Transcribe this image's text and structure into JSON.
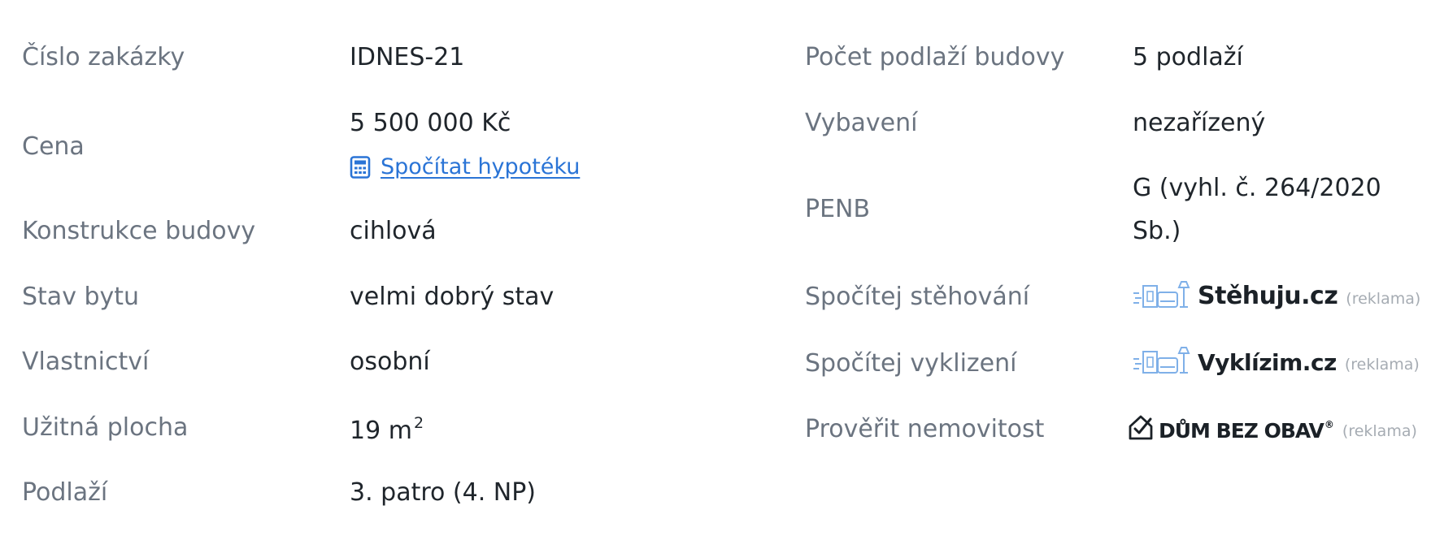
{
  "left": {
    "order_number": {
      "label": "Číslo zakázky",
      "value": "IDNES-21"
    },
    "price": {
      "label": "Cena",
      "value": "5 500 000 Kč",
      "link": "Spočítat hypotéku"
    },
    "construction": {
      "label": "Konstrukce budovy",
      "value": "cihlová"
    },
    "condition": {
      "label": "Stav bytu",
      "value": "velmi dobrý stav"
    },
    "ownership": {
      "label": "Vlastnictví",
      "value": "osobní"
    },
    "area": {
      "label": "Užitná plocha",
      "value": "19 m",
      "unit_sup": "2"
    },
    "floor": {
      "label": "Podlaží",
      "value": "3. patro (4. NP)"
    }
  },
  "right": {
    "building_floors": {
      "label": "Počet podlaží budovy",
      "value": "5 podlaží"
    },
    "furnishing": {
      "label": "Vybavení",
      "value": "nezařízený"
    },
    "penb": {
      "label": "PENB",
      "value_line1": "G (vyhl. č. 264/2020",
      "value_line2": "Sb.)"
    },
    "moving": {
      "label": "Spočítej stěhování",
      "brand": "Stěhuju.cz",
      "note": "(reklama)"
    },
    "clearing": {
      "label": "Spočítej vyklizení",
      "brand": "Vyklízim.cz",
      "note": "(reklama)"
    },
    "verify": {
      "label": "Prověřit nemovitost",
      "brand": "DŮM BEZ OBAV",
      "reg": "®",
      "note": "(reklama)"
    }
  },
  "colors": {
    "label": "#6b7480",
    "value": "#1f252b",
    "link": "#2a74d6",
    "ad_icon": "#7fb0e8",
    "note": "#a6acb3"
  },
  "icons": [
    "calculator-icon",
    "moving-van-icon",
    "moving-van-icon",
    "house-check-icon"
  ]
}
